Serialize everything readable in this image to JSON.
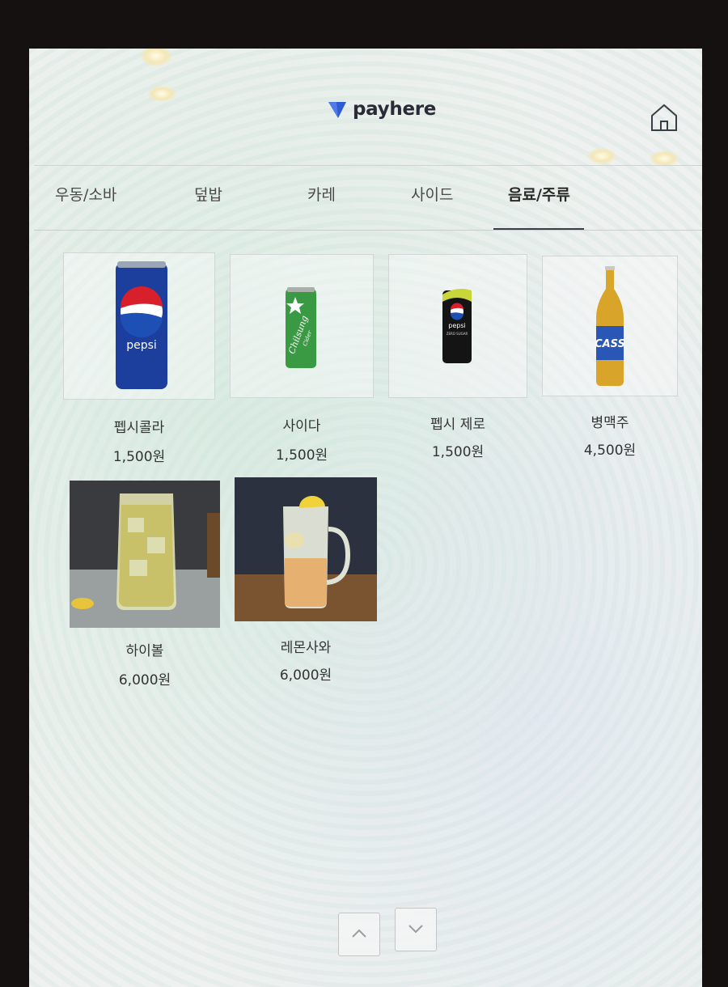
{
  "header": {
    "brand": "payhere",
    "home_icon": "home-icon"
  },
  "tabs": [
    {
      "label": "우동/소바",
      "active": false
    },
    {
      "label": "덮밥",
      "active": false
    },
    {
      "label": "카레",
      "active": false
    },
    {
      "label": "사이드",
      "active": false
    },
    {
      "label": "음료/주류",
      "active": true
    }
  ],
  "menu": [
    {
      "name": "펩시콜라",
      "price": "1,500원"
    },
    {
      "name": "사이다",
      "price": "1,500원"
    },
    {
      "name": "펩시 제로",
      "price": "1,500원"
    },
    {
      "name": "병맥주",
      "price": "4,500원"
    },
    {
      "name": "하이볼",
      "price": "6,000원"
    },
    {
      "name": "레몬사와",
      "price": "6,000원"
    }
  ],
  "products": {
    "pepsi_can": "pepsi",
    "chilsung_can": "Chilsung",
    "chilsung_sub": "Cider",
    "pepsi_zero_can": "pepsi",
    "pepsi_zero_sub": "ZERO SUGAR",
    "cass_bottle": "CASS"
  },
  "pager": {
    "up_icon": "chevron-up-icon",
    "down_icon": "chevron-down-icon"
  },
  "colors": {
    "accent": "#3b3f48",
    "logo_blue": "#2f5bd4",
    "pepsi_blue": "#1c3f9e",
    "chilsung_green": "#3a9a44",
    "cass_blue": "#2a56b5"
  }
}
